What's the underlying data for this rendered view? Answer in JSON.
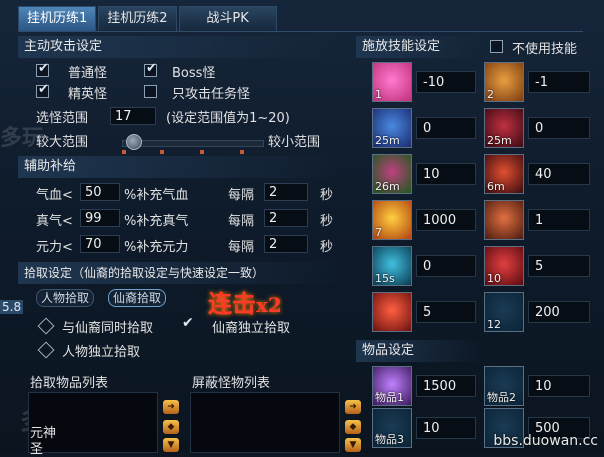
{
  "tabs": [
    "挂机历练1",
    "挂机历练2",
    "战斗PK"
  ],
  "attack": {
    "title": "主动攻击设定",
    "normal_label": "普通怪",
    "normal_checked": true,
    "boss_label": "Boss怪",
    "boss_checked": true,
    "elite_label": "精英怪",
    "elite_checked": true,
    "quest_only_label": "只攻击任务怪",
    "quest_only_checked": false,
    "range_label": "选怪范围",
    "range_value": "17",
    "range_hint": "(设定范围值为1~20)",
    "large_range_label": "较大范围",
    "small_range_label": "较小范围",
    "range_slider_fraction": 0.05
  },
  "supply": {
    "title": "辅助补给",
    "rows": [
      {
        "label": "气血<",
        "value": "50",
        "suffix": "%补充气血",
        "every": "每隔",
        "interval": "2",
        "unit": "秒"
      },
      {
        "label": "真气<",
        "value": "99",
        "suffix": "%补充真气",
        "every": "每隔",
        "interval": "2",
        "unit": "秒"
      },
      {
        "label": "元力<",
        "value": "70",
        "suffix": "%补充元力",
        "every": "每隔",
        "interval": "2",
        "unit": "秒"
      }
    ]
  },
  "pickup": {
    "title": "拾取设定（仙裔的拾取设定与快速设定一致）",
    "subtab_person": "人物拾取",
    "subtab_fairy": "仙裔拾取",
    "side_value": "5.8",
    "options": [
      {
        "label": "与仙裔同时拾取",
        "checked": false
      },
      {
        "label": "仙裔独立拾取",
        "checked": true
      },
      {
        "label": "人物独立拾取",
        "checked": false
      }
    ],
    "list_title": "拾取物品列表",
    "block_title": "屏蔽怪物列表",
    "list_items": [
      "元神",
      "圣"
    ]
  },
  "skills": {
    "title": "施放技能设定",
    "no_skill_label": "不使用技能",
    "no_skill_checked": false,
    "slots": [
      {
        "cap": "1",
        "value": "-10",
        "color1": "#c0307a",
        "color2": "#ff7ad0"
      },
      {
        "cap": "2",
        "value": "-1",
        "color1": "#7a3a10",
        "color2": "#e8a040"
      },
      {
        "cap": "25m",
        "value": "0",
        "color1": "#1a2a70",
        "color2": "#4a8ae0"
      },
      {
        "cap": "25m",
        "value": "0",
        "color1": "#3a0a14",
        "color2": "#c03040"
      },
      {
        "cap": "26m",
        "value": "10",
        "color1": "#1a5a1a",
        "color2": "#c04080"
      },
      {
        "cap": "6m",
        "value": "40",
        "color1": "#3a0a10",
        "color2": "#e05030"
      },
      {
        "cap": "7",
        "value": "1000",
        "color1": "#b04010",
        "color2": "#ffd040"
      },
      {
        "cap": "",
        "value": "1",
        "color1": "#4a1a10",
        "color2": "#e07040"
      },
      {
        "cap": "15s",
        "value": "0",
        "color1": "#0a3a50",
        "color2": "#40c0e0"
      },
      {
        "cap": "10",
        "value": "5",
        "color1": "#5a0a10",
        "color2": "#e04040"
      },
      {
        "cap": "",
        "value": "5",
        "color1": "#6a1010",
        "color2": "#ff6040"
      },
      {
        "cap": "12",
        "value": "200",
        "color1": "#0a2436",
        "color2": "#1a3a54"
      }
    ]
  },
  "items": {
    "title": "物品设定",
    "slots": [
      {
        "cap": "物品1",
        "value": "1500",
        "color1": "#3a1a5a",
        "color2": "#c080ff"
      },
      {
        "cap": "物品2",
        "value": "10",
        "color1": "#0a2436",
        "color2": "#1a3a54"
      },
      {
        "cap": "物品3",
        "value": "10",
        "color1": "#0a2436",
        "color2": "#1a3a54"
      },
      {
        "cap": "",
        "value": "500",
        "color1": "#0a2436",
        "color2": "#1a3a54"
      }
    ]
  },
  "overlay": {
    "combo_text": "连击",
    "combo_count": "x2",
    "footer_watermark": "bbs.duowan.cc",
    "watermark_texts": [
      "多玩",
      "多玩",
      "多玩"
    ]
  },
  "colors": {
    "accent": "#4f86b8",
    "combo": "#ff3a2a"
  }
}
